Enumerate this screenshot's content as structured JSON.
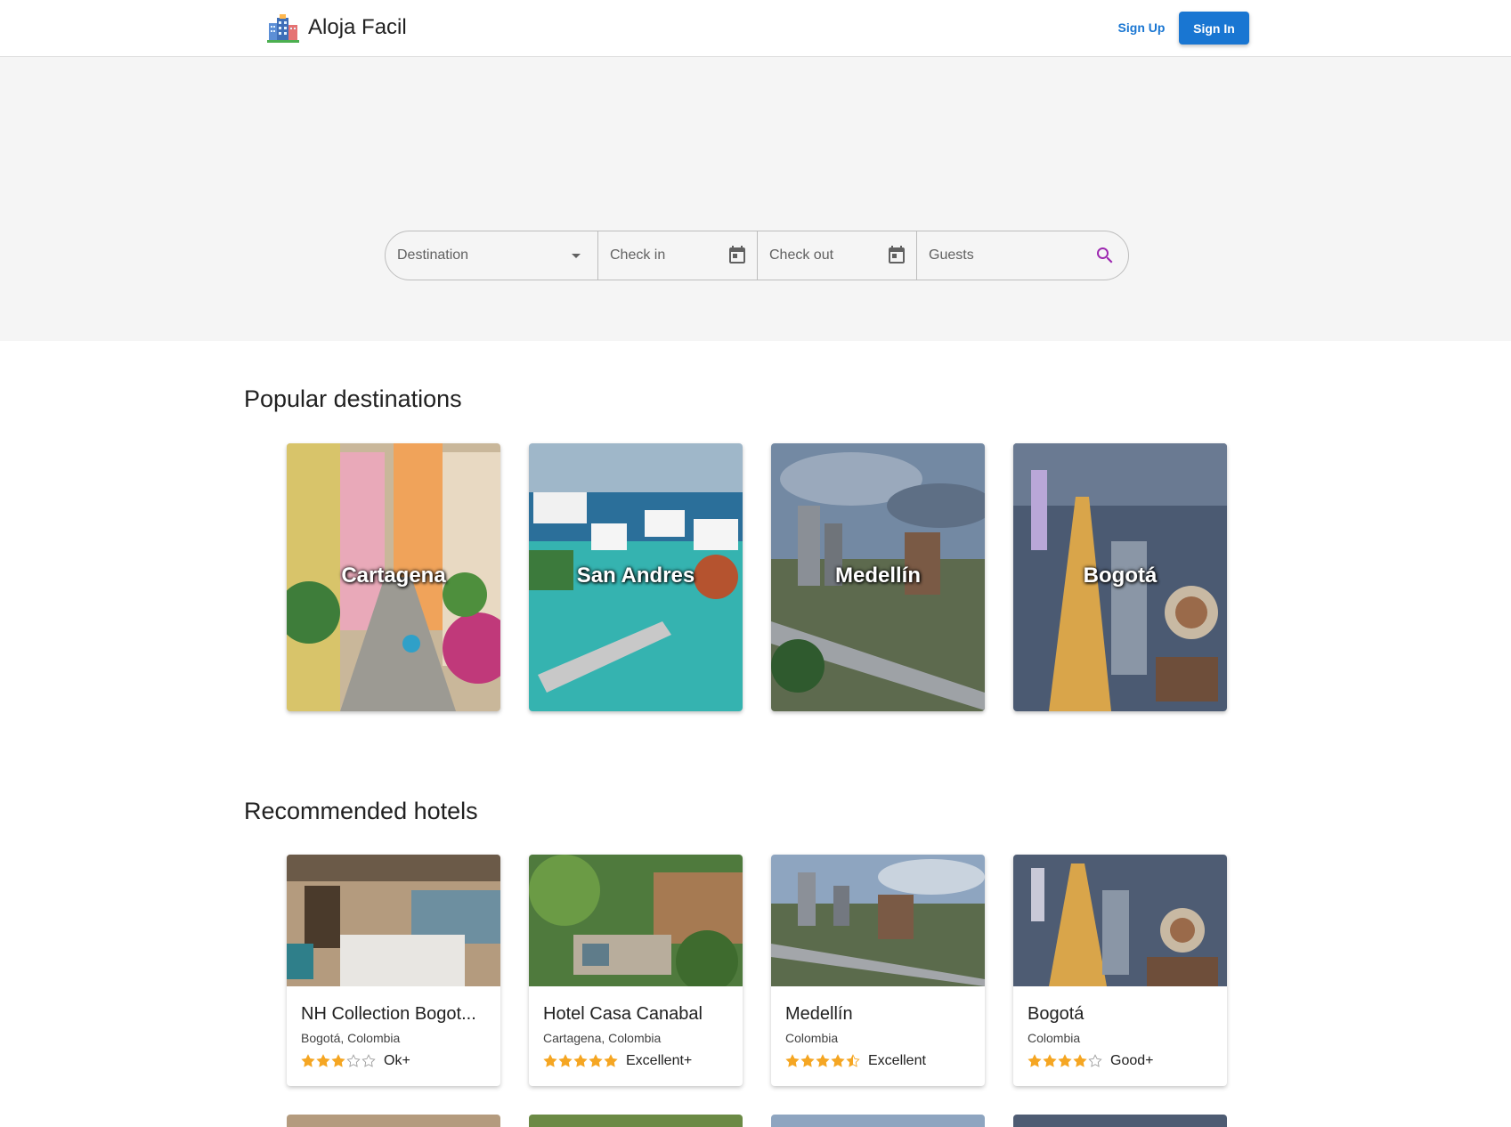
{
  "header": {
    "brand": "Aloja Facil",
    "sign_up_label": "Sign Up",
    "sign_in_label": "Sign In"
  },
  "search": {
    "destination_placeholder": "Destination",
    "check_in_placeholder": "Check in",
    "check_out_placeholder": "Check out",
    "guests_placeholder": "Guests",
    "icons": [
      "dropdown-arrow-icon",
      "calendar-icon",
      "calendar-icon",
      "search-icon"
    ]
  },
  "popular": {
    "title": "Popular destinations",
    "items": [
      {
        "label": "Cartagena"
      },
      {
        "label": "San Andres"
      },
      {
        "label": "Medellín"
      },
      {
        "label": "Bogotá"
      }
    ]
  },
  "hotels": {
    "title": "Recommended hotels",
    "items": [
      {
        "name": "NH Collection Bogot...",
        "location": "Bogotá, Colombia",
        "stars": 3,
        "rating_label": "Ok+"
      },
      {
        "name": "Hotel Casa Canabal",
        "location": "Cartagena, Colombia",
        "stars": 5,
        "rating_label": "Excellent+"
      },
      {
        "name": "Medellín",
        "location": "Colombia",
        "stars": 4.5,
        "rating_label": "Excellent"
      },
      {
        "name": "Bogotá",
        "location": "Colombia",
        "stars": 4,
        "rating_label": "Good+"
      }
    ]
  },
  "colors": {
    "primary": "#1976d2",
    "star": "#f5a623",
    "hero_bg": "#f5f5f5",
    "search_icon": "#9c27b0"
  }
}
